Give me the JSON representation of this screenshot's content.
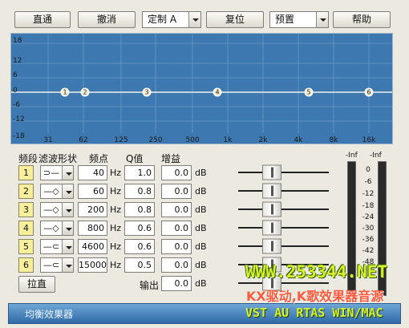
{
  "toolbar": {
    "bypass": "直通",
    "undo": "撤消",
    "custom_value": "定制 A",
    "reset": "复位",
    "preset_value": "预置",
    "help": "帮助"
  },
  "graph": {
    "y_labels": [
      "18",
      "12",
      "6",
      "0",
      "-6",
      "-12",
      "-18"
    ],
    "x_labels": [
      "31",
      "62",
      "125",
      "250",
      "500",
      "1k",
      "2k",
      "4k",
      "8k",
      "16k"
    ],
    "nodes": [
      "1",
      "2",
      "3",
      "4",
      "5",
      "6"
    ]
  },
  "headers": {
    "band": "频段",
    "shape": "滤波形状",
    "freq": "频点",
    "q": "Q值",
    "gain": "增益"
  },
  "bands": [
    {
      "num": "1",
      "shape": "low-shelf-icon",
      "freq": "40",
      "q": "1.0",
      "gain": "0.0"
    },
    {
      "num": "2",
      "shape": "peak-icon",
      "freq": "60",
      "q": "0.8",
      "gain": "0.0"
    },
    {
      "num": "3",
      "shape": "peak-icon",
      "freq": "200",
      "q": "0.8",
      "gain": "0.0"
    },
    {
      "num": "4",
      "shape": "peak-icon",
      "freq": "800",
      "q": "0.6",
      "gain": "0.0"
    },
    {
      "num": "5",
      "shape": "high-shelf-icon",
      "freq": "4600",
      "q": "0.6",
      "gain": "0.0"
    },
    {
      "num": "6",
      "shape": "high-shelf-icon",
      "freq": "15000",
      "q": "0.5",
      "gain": "0.0"
    }
  ],
  "units": {
    "hz": "Hz",
    "db": "dB"
  },
  "output": {
    "label": "输出",
    "value": "0.0"
  },
  "flatten": "拉直",
  "meter": {
    "left_peak": "-Inf",
    "right_peak": "-Inf",
    "scale": [
      "0",
      "-6",
      "-12",
      "-18",
      "-24",
      "-30",
      "-36",
      "-42",
      "-48"
    ]
  },
  "footer": {
    "title": "均衡效果器"
  },
  "watermark": {
    "line1": "WWW.253344.NET",
    "line2": "KX驱动,K歌效果器音源",
    "line3": "VST AU RTAS WIN/MAC"
  }
}
